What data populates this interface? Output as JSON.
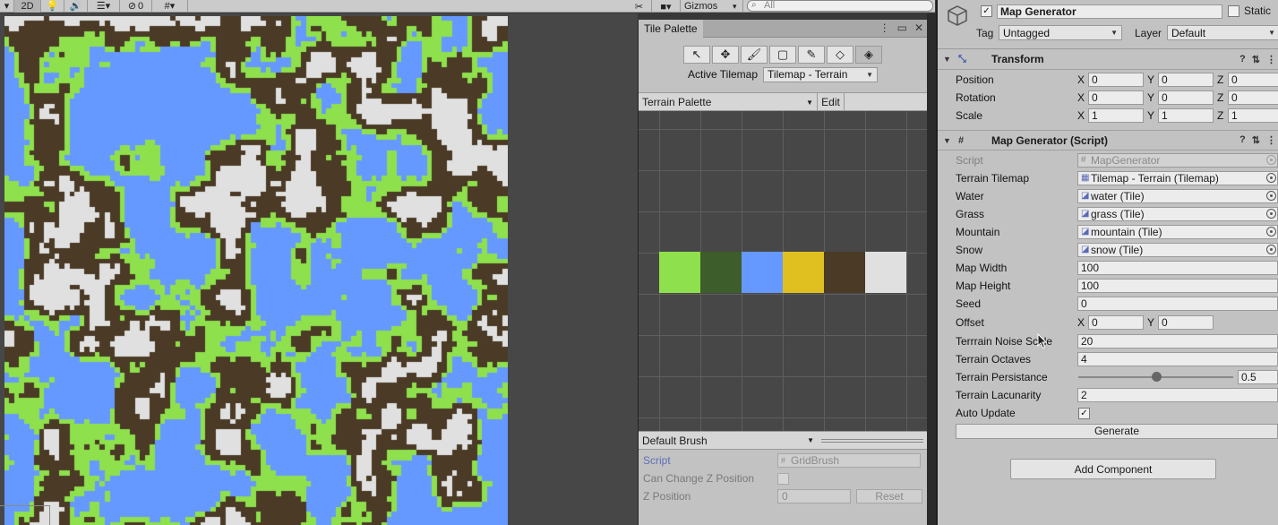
{
  "scene_toolbar": {
    "mode_2d": "2D",
    "hidden_count": "0",
    "gizmos_label": "Gizmos",
    "search_placeholder": "All"
  },
  "scene": {
    "map_colors": {
      "water": "#6699ff",
      "grass": "#8ee04c",
      "mountain": "#4a3a26",
      "snow": "#e0e0e0"
    }
  },
  "tile_palette": {
    "tab_title": "Tile Palette",
    "tools": [
      "select-icon",
      "move-icon",
      "paint-brush-icon",
      "box-fill-icon",
      "picker-icon",
      "eraser-icon",
      "fill-icon"
    ],
    "active_tilemap_label": "Active Tilemap",
    "active_tilemap_value": "Tilemap - Terrain",
    "palette_name": "Terrain Palette",
    "edit_label": "Edit",
    "tiles": [
      "#8ee04c",
      "#3d5d2a",
      "#6699ff",
      "#e0c020",
      "#4a3a26",
      "#e0e0e0"
    ],
    "brush": {
      "name": "Default Brush",
      "script_label": "Script",
      "script_value": "GridBrush",
      "can_change_z_label": "Can Change Z Position",
      "z_position_label": "Z Position",
      "z_position_value": "0",
      "reset_label": "Reset"
    }
  },
  "inspector": {
    "object_name": "Map Generator",
    "static_label": "Static",
    "tag_label": "Tag",
    "tag_value": "Untagged",
    "layer_label": "Layer",
    "layer_value": "Default",
    "transform": {
      "title": "Transform",
      "position_label": "Position",
      "rotation_label": "Rotation",
      "scale_label": "Scale",
      "position": {
        "x": "0",
        "y": "0",
        "z": "0"
      },
      "rotation": {
        "x": "0",
        "y": "0",
        "z": "0"
      },
      "scale": {
        "x": "1",
        "y": "1",
        "z": "1"
      }
    },
    "script_component": {
      "title": "Map Generator (Script)",
      "script_label": "Script",
      "script_value": "MapGenerator",
      "terrain_tilemap_label": "Terrain Tilemap",
      "terrain_tilemap_value": "Tilemap - Terrain (Tilemap)",
      "water_label": "Water",
      "water_value": "water (Tile)",
      "grass_label": "Grass",
      "grass_value": "grass (Tile)",
      "mountain_label": "Mountain",
      "mountain_value": "mountain (Tile)",
      "snow_label": "Snow",
      "snow_value": "snow (Tile)",
      "map_width_label": "Map Width",
      "map_width_value": "100",
      "map_height_label": "Map Height",
      "map_height_value": "100",
      "seed_label": "Seed",
      "seed_value": "0",
      "offset_label": "Offset",
      "offset_x": "0",
      "offset_y": "0",
      "noise_scale_label": "Terrrain Noise Scale",
      "noise_scale_value": "20",
      "octaves_label": "Terrain Octaves",
      "octaves_value": "4",
      "persistance_label": "Terrain Persistance",
      "persistance_value": "0.5",
      "persistance_fraction": 0.5,
      "lacunarity_label": "Terrain Lacunarity",
      "lacunarity_value": "2",
      "auto_update_label": "Auto Update",
      "auto_update_checked": true,
      "generate_label": "Generate"
    },
    "add_component_label": "Add Component"
  }
}
